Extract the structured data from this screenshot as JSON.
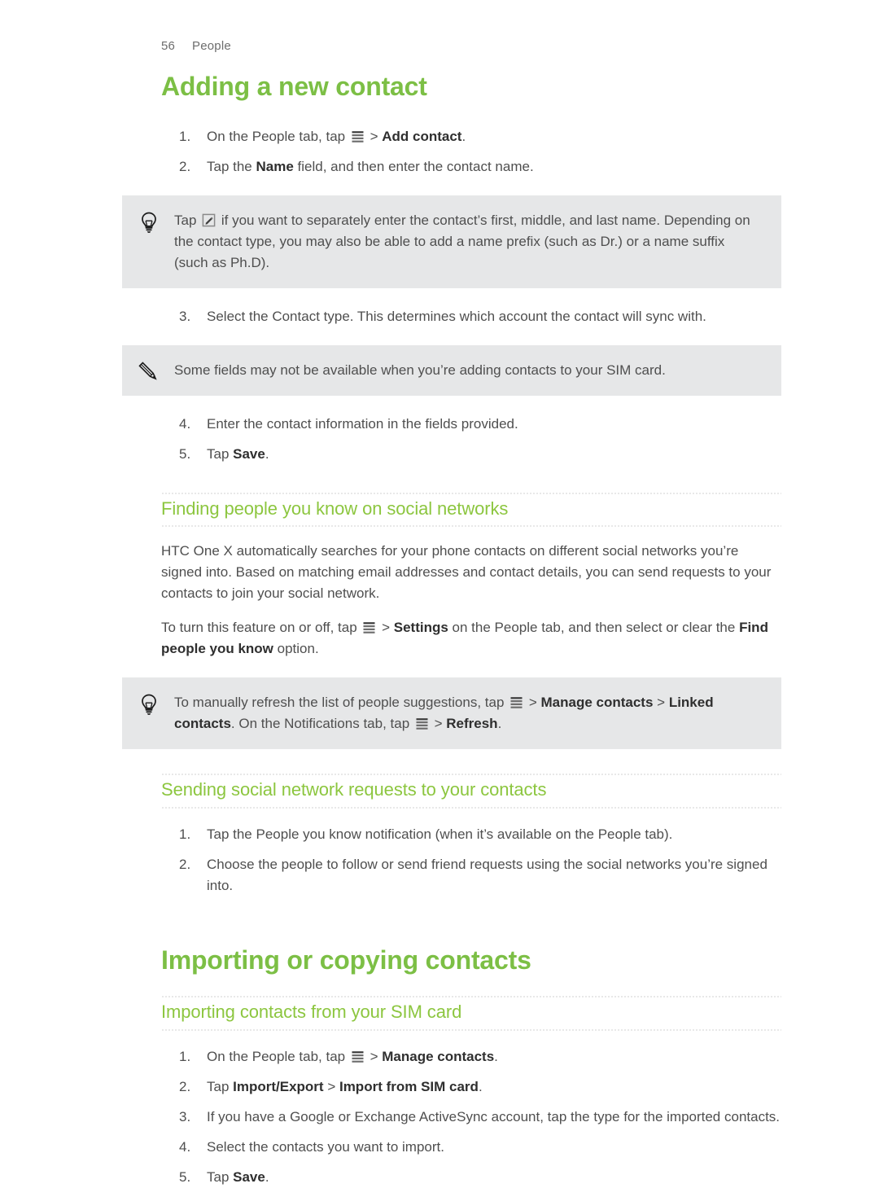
{
  "page": {
    "number": "56",
    "section": "People",
    "accent_heading": "#7cbf45",
    "accent_subheading": "#8cc63f",
    "callout_bg": "#e6e7e8"
  },
  "sections": [
    {
      "id": "adding-a-new-contact",
      "title": "Adding a new contact",
      "steps_1": [
        {
          "num": "1.",
          "parts": [
            {
              "t": "text",
              "v": "On the People tab, tap "
            },
            {
              "t": "icon",
              "v": "menu-icon"
            },
            {
              "t": "text",
              "v": " > "
            },
            {
              "t": "bold",
              "v": "Add contact"
            },
            {
              "t": "text",
              "v": "."
            }
          ]
        },
        {
          "num": "2.",
          "parts": [
            {
              "t": "text",
              "v": "Tap the "
            },
            {
              "t": "bold",
              "v": "Name"
            },
            {
              "t": "text",
              "v": " field, and then enter the contact name."
            }
          ]
        }
      ],
      "tip_1": {
        "icon": "lightbulb-icon",
        "parts": [
          {
            "t": "text",
            "v": "Tap "
          },
          {
            "t": "icon",
            "v": "edit-icon"
          },
          {
            "t": "text",
            "v": " if you want to separately enter the contact’s first, middle, and last name. Depending on the contact type, you may also be able to add a name prefix (such as Dr.) or a name suffix (such as Ph.D)."
          }
        ]
      },
      "steps_2": [
        {
          "num": "3.",
          "parts": [
            {
              "t": "text",
              "v": "Select the Contact type. This determines which account the contact will sync with."
            }
          ]
        }
      ],
      "note_1": {
        "icon": "pencil-icon",
        "parts": [
          {
            "t": "text",
            "v": "Some fields may not be available when you’re adding contacts to your SIM card."
          }
        ]
      },
      "steps_3": [
        {
          "num": "4.",
          "parts": [
            {
              "t": "text",
              "v": "Enter the contact information in the fields provided."
            }
          ]
        },
        {
          "num": "5.",
          "parts": [
            {
              "t": "text",
              "v": "Tap "
            },
            {
              "t": "bold",
              "v": "Save"
            },
            {
              "t": "text",
              "v": "."
            }
          ]
        }
      ]
    },
    {
      "id": "finding-people-you-know",
      "title": "Finding people you know on social networks",
      "paragraphs": [
        {
          "parts": [
            {
              "t": "text",
              "v": "HTC One X automatically searches for your phone contacts on different social networks you’re signed into. Based on matching email addresses and contact details, you can send requests to your contacts to join your social network."
            }
          ]
        },
        {
          "parts": [
            {
              "t": "text",
              "v": "To turn this feature on or off, tap "
            },
            {
              "t": "icon",
              "v": "menu-icon"
            },
            {
              "t": "text",
              "v": " > "
            },
            {
              "t": "bold",
              "v": "Settings"
            },
            {
              "t": "text",
              "v": " on the People tab, and then select or clear the "
            },
            {
              "t": "bold",
              "v": "Find people you know"
            },
            {
              "t": "text",
              "v": " option."
            }
          ]
        }
      ],
      "tip_1": {
        "icon": "lightbulb-icon",
        "parts": [
          {
            "t": "text",
            "v": "To manually refresh the list of people suggestions, tap "
          },
          {
            "t": "icon",
            "v": "menu-icon"
          },
          {
            "t": "text",
            "v": " > "
          },
          {
            "t": "bold",
            "v": "Manage contacts"
          },
          {
            "t": "text",
            "v": " > "
          },
          {
            "t": "bold",
            "v": "Linked contacts"
          },
          {
            "t": "text",
            "v": ". On the Notifications tab, tap "
          },
          {
            "t": "icon",
            "v": "menu-icon"
          },
          {
            "t": "text",
            "v": " > "
          },
          {
            "t": "bold",
            "v": "Refresh"
          },
          {
            "t": "text",
            "v": "."
          }
        ]
      }
    },
    {
      "id": "sending-social-network-requests",
      "title": "Sending social network requests to your contacts",
      "steps_1": [
        {
          "num": "1.",
          "parts": [
            {
              "t": "text",
              "v": "Tap the People you know notification (when it’s available on the People tab)."
            }
          ]
        },
        {
          "num": "2.",
          "parts": [
            {
              "t": "text",
              "v": "Choose the people to follow or send friend requests using the social networks you’re signed into."
            }
          ]
        }
      ]
    },
    {
      "id": "importing-or-copying-contacts",
      "title": "Importing or copying contacts"
    },
    {
      "id": "importing-contacts-from-sim",
      "title": "Importing contacts from your SIM card",
      "steps_1": [
        {
          "num": "1.",
          "parts": [
            {
              "t": "text",
              "v": "On the People tab, tap "
            },
            {
              "t": "icon",
              "v": "menu-icon"
            },
            {
              "t": "text",
              "v": " > "
            },
            {
              "t": "bold",
              "v": "Manage contacts"
            },
            {
              "t": "text",
              "v": "."
            }
          ]
        },
        {
          "num": "2.",
          "parts": [
            {
              "t": "text",
              "v": "Tap "
            },
            {
              "t": "bold",
              "v": "Import/Export"
            },
            {
              "t": "text",
              "v": " > "
            },
            {
              "t": "bold",
              "v": "Import from SIM card"
            },
            {
              "t": "text",
              "v": "."
            }
          ]
        },
        {
          "num": "3.",
          "parts": [
            {
              "t": "text",
              "v": "If you have a Google or Exchange ActiveSync account, tap the type for the imported contacts."
            }
          ]
        },
        {
          "num": "4.",
          "parts": [
            {
              "t": "text",
              "v": "Select the contacts you want to import."
            }
          ]
        },
        {
          "num": "5.",
          "parts": [
            {
              "t": "text",
              "v": "Tap "
            },
            {
              "t": "bold",
              "v": "Save"
            },
            {
              "t": "text",
              "v": "."
            }
          ]
        }
      ]
    }
  ]
}
